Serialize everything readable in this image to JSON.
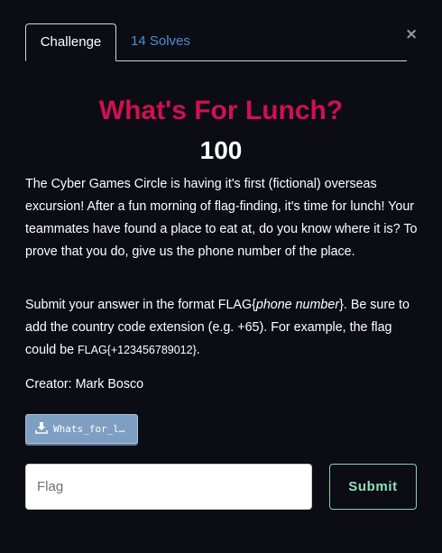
{
  "modal": {
    "close_label": "×",
    "tabs": [
      {
        "label": "Challenge"
      },
      {
        "label": "14 Solves"
      }
    ]
  },
  "challenge": {
    "title": "What's For Lunch?",
    "points": "100",
    "description_p1": "The Cyber Games Circle is having it's first (fictional) overseas excursion! After a fun morning of flag-finding, it's time for lunch! Your teammates have found a place to eat at, do you know where it is? To prove that you do, give us the phone number of the place.",
    "description_p2_a": "Submit your answer in the format FLAG{",
    "description_p2_em": "phone number",
    "description_p2_b": "}. Be sure to add the country code extension (e.g. +65). For example, the flag could be ",
    "description_p2_code": "FLAG{+123456789012}",
    "description_p2_c": ".",
    "creator": "Creator: Mark Bosco",
    "attachment_label": "Whats_for_l…",
    "attachment_icon": "download-icon"
  },
  "form": {
    "flag_placeholder": "Flag",
    "flag_value": "",
    "submit_label": "Submit"
  },
  "colors": {
    "background": "#0c0c14",
    "title": "#d1104f",
    "tab_link": "#4d8fd6",
    "submit_accent": "#8fe0bc",
    "attachment_button": "#7f9fc2"
  }
}
